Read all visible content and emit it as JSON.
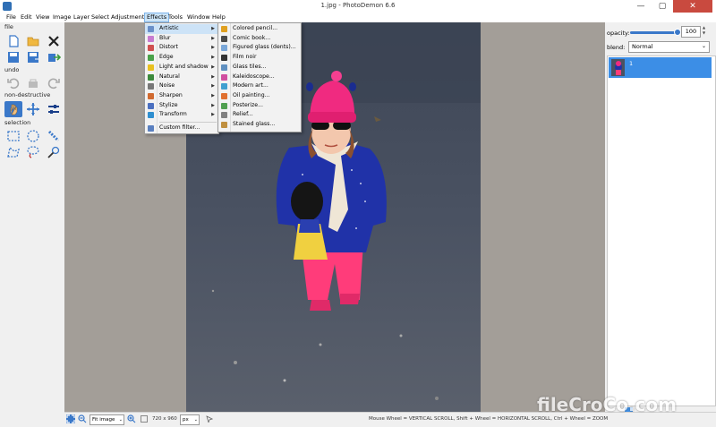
{
  "window": {
    "title": "1.jpg  -  PhotoDemon 6.6",
    "minimize": "—",
    "maximize": "▢",
    "close": "✕"
  },
  "menubar": [
    "File",
    "Edit",
    "View",
    "Image",
    "Layer",
    "Select",
    "Adjustments",
    "Effects",
    "Tools",
    "Window",
    "Help"
  ],
  "toolbox": {
    "file_label": "file",
    "undo_label": "undo",
    "nondestructive_label": "non-destructive",
    "selection_label": "selection"
  },
  "effects_menu": {
    "items": [
      {
        "label": "Artistic",
        "icon_color": "#6a8fc8",
        "submenu": true
      },
      {
        "label": "Blur",
        "icon_color": "#c77bd0",
        "submenu": true
      },
      {
        "label": "Distort",
        "icon_color": "#d05050",
        "submenu": true
      },
      {
        "label": "Edge",
        "icon_color": "#4aa24a",
        "submenu": true
      },
      {
        "label": "Light and shadow",
        "icon_color": "#e8c020",
        "submenu": true
      },
      {
        "label": "Natural",
        "icon_color": "#3c8a3c",
        "submenu": true
      },
      {
        "label": "Noise",
        "icon_color": "#777777",
        "submenu": true
      },
      {
        "label": "Sharpen",
        "icon_color": "#d06a30",
        "submenu": true
      },
      {
        "label": "Stylize",
        "icon_color": "#4a6fc0",
        "submenu": true
      },
      {
        "label": "Transform",
        "icon_color": "#2f8fd0",
        "submenu": true
      }
    ],
    "custom": {
      "label": "Custom filter...",
      "icon_color": "#5a80c0"
    }
  },
  "artistic_menu": {
    "items": [
      {
        "label": "Colored pencil...",
        "icon_color": "#e0a020"
      },
      {
        "label": "Comic book...",
        "icon_color": "#4a4a4a"
      },
      {
        "label": "Figured glass (dents)...",
        "icon_color": "#7aa7d8"
      },
      {
        "label": "Film noir",
        "icon_color": "#333333"
      },
      {
        "label": "Glass tiles...",
        "icon_color": "#6090c0"
      },
      {
        "label": "Kaleidoscope...",
        "icon_color": "#d04fa0"
      },
      {
        "label": "Modern art...",
        "icon_color": "#40a0d0"
      },
      {
        "label": "Oil painting...",
        "icon_color": "#e07030"
      },
      {
        "label": "Posterize...",
        "icon_color": "#50a050"
      },
      {
        "label": "Relief...",
        "icon_color": "#808080"
      },
      {
        "label": "Stained glass...",
        "icon_color": "#c09040"
      }
    ]
  },
  "right_panel": {
    "opacity_label": "opacity:",
    "opacity_value": "100",
    "opacity_level": 1.0,
    "blend_label": "blend:",
    "blend_value": "Normal",
    "layer_name": "1"
  },
  "statusbar": {
    "zoom_value": "Fit image",
    "image_size": "720 x 960",
    "unit": "px",
    "help_text": "Mouse Wheel = VERTICAL SCROLL, Shift + Wheel = HORIZONTAL SCROLL, Ctrl + Wheel = ZOOM"
  },
  "watermark": "fileCroCo.com",
  "colors": {
    "accent": "#3a78c9",
    "canvas_bg": "#a39e98",
    "highlight": "#cde3f7",
    "layer_selected": "#3c8ee6"
  }
}
